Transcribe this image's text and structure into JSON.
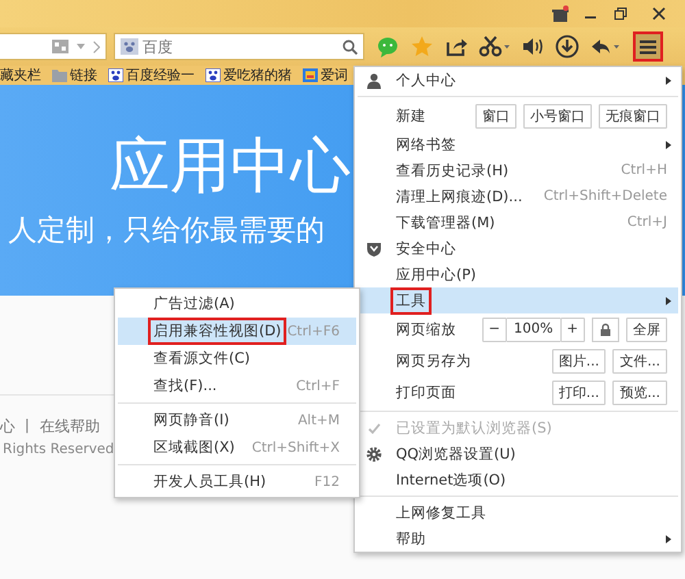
{
  "search": {
    "placeholder": "百度"
  },
  "toolbar": {
    "menu_button": {
      "highlighted": true
    }
  },
  "bookmarks": [
    {
      "label": "藏夹栏",
      "kind": "plain"
    },
    {
      "label": "链接",
      "kind": "folder"
    },
    {
      "label": "百度经验一",
      "kind": "paw"
    },
    {
      "label": "爱吃猪的猪",
      "kind": "paw"
    },
    {
      "label": "爱词",
      "kind": "app"
    }
  ],
  "page": {
    "title": "应用中心",
    "subtitle": "人定制，只给你最需要的",
    "footer_links": "心 丨 在线帮助",
    "copyright": "Rights Reserved"
  },
  "main_menu": {
    "groups": [
      [
        {
          "label": "个人中心",
          "kind": "user",
          "submenu": true,
          "selected": false,
          "highlighted": false,
          "disabled": false,
          "checked": false
        }
      ],
      [
        {
          "label": "新建",
          "submenu": false,
          "selected": false,
          "highlighted": false,
          "disabled": false,
          "checked": false,
          "controls": [
            {
              "kind": "button",
              "text": "窗口"
            },
            {
              "kind": "button",
              "text": "小号窗口"
            },
            {
              "kind": "button",
              "text": "无痕窗口"
            }
          ]
        },
        {
          "label": "网络书签",
          "submenu": true,
          "selected": false,
          "highlighted": false,
          "disabled": false,
          "checked": false
        },
        {
          "label": "查看历史记录(H)",
          "shortcut": "Ctrl+H",
          "submenu": false,
          "selected": false,
          "highlighted": false,
          "disabled": false,
          "checked": false
        },
        {
          "label": "清理上网痕迹(D)...",
          "shortcut": "Ctrl+Shift+Delete",
          "submenu": false,
          "selected": false,
          "highlighted": false,
          "disabled": false,
          "checked": false
        },
        {
          "label": "下载管理器(M)",
          "shortcut": "Ctrl+J",
          "submenu": false,
          "selected": false,
          "highlighted": false,
          "disabled": false,
          "checked": false
        },
        {
          "label": "安全中心",
          "kind": "shield",
          "submenu": false,
          "selected": false,
          "highlighted": false,
          "disabled": false,
          "checked": false
        },
        {
          "label": "应用中心(P)",
          "submenu": false,
          "selected": false,
          "highlighted": false,
          "disabled": false,
          "checked": false
        },
        {
          "label": "工具",
          "submenu": true,
          "selected": true,
          "highlighted": true,
          "disabled": false,
          "checked": false
        },
        {
          "label": "网页缩放",
          "submenu": false,
          "selected": false,
          "highlighted": false,
          "disabled": false,
          "checked": false,
          "controls": [
            {
              "kind": "button",
              "text": "−"
            },
            {
              "kind": "readout",
              "text": "100%"
            },
            {
              "kind": "button",
              "text": "+"
            },
            {
              "kind": "lock"
            },
            {
              "kind": "button",
              "text": "全屏"
            }
          ]
        },
        {
          "label": "网页另存为",
          "submenu": false,
          "selected": false,
          "highlighted": false,
          "disabled": false,
          "checked": false,
          "controls": [
            {
              "kind": "button",
              "text": "图片..."
            },
            {
              "kind": "button",
              "text": "文件..."
            }
          ]
        },
        {
          "label": "打印页面",
          "submenu": false,
          "selected": false,
          "highlighted": false,
          "disabled": false,
          "checked": false,
          "controls": [
            {
              "kind": "button",
              "text": "打印..."
            },
            {
              "kind": "button",
              "text": "预览..."
            }
          ]
        }
      ],
      [
        {
          "label": "已设置为默认浏览器(S)",
          "submenu": false,
          "selected": false,
          "highlighted": false,
          "disabled": true,
          "checked": true
        },
        {
          "label": "QQ浏览器设置(U)",
          "kind": "gear",
          "submenu": false,
          "selected": false,
          "highlighted": false,
          "disabled": false,
          "checked": false
        },
        {
          "label": "Internet选项(O)",
          "submenu": false,
          "selected": false,
          "highlighted": false,
          "disabled": false,
          "checked": false
        }
      ],
      [
        {
          "label": "上网修复工具",
          "submenu": false,
          "selected": false,
          "highlighted": false,
          "disabled": false,
          "checked": false
        },
        {
          "label": "帮助",
          "submenu": true,
          "selected": false,
          "highlighted": false,
          "disabled": false,
          "checked": false
        }
      ]
    ]
  },
  "sub_menu": {
    "groups": [
      [
        {
          "label": "广告过滤(A)",
          "selected": false,
          "highlighted": false
        },
        {
          "label": "启用兼容性视图(D)",
          "shortcut": "Ctrl+F6",
          "selected": true,
          "highlighted": true
        },
        {
          "label": "查看源文件(C)",
          "selected": false,
          "highlighted": false
        },
        {
          "label": "查找(F)...",
          "shortcut": "Ctrl+F",
          "selected": false,
          "highlighted": false
        }
      ],
      [
        {
          "label": "网页静音(I)",
          "shortcut": "Alt+M",
          "selected": false,
          "highlighted": false
        },
        {
          "label": "区域截图(X)",
          "shortcut": "Ctrl+Shift+X",
          "selected": false,
          "highlighted": false
        }
      ],
      [
        {
          "label": "开发人员工具(H)",
          "shortcut": "F12",
          "selected": false,
          "highlighted": false
        }
      ]
    ]
  }
}
